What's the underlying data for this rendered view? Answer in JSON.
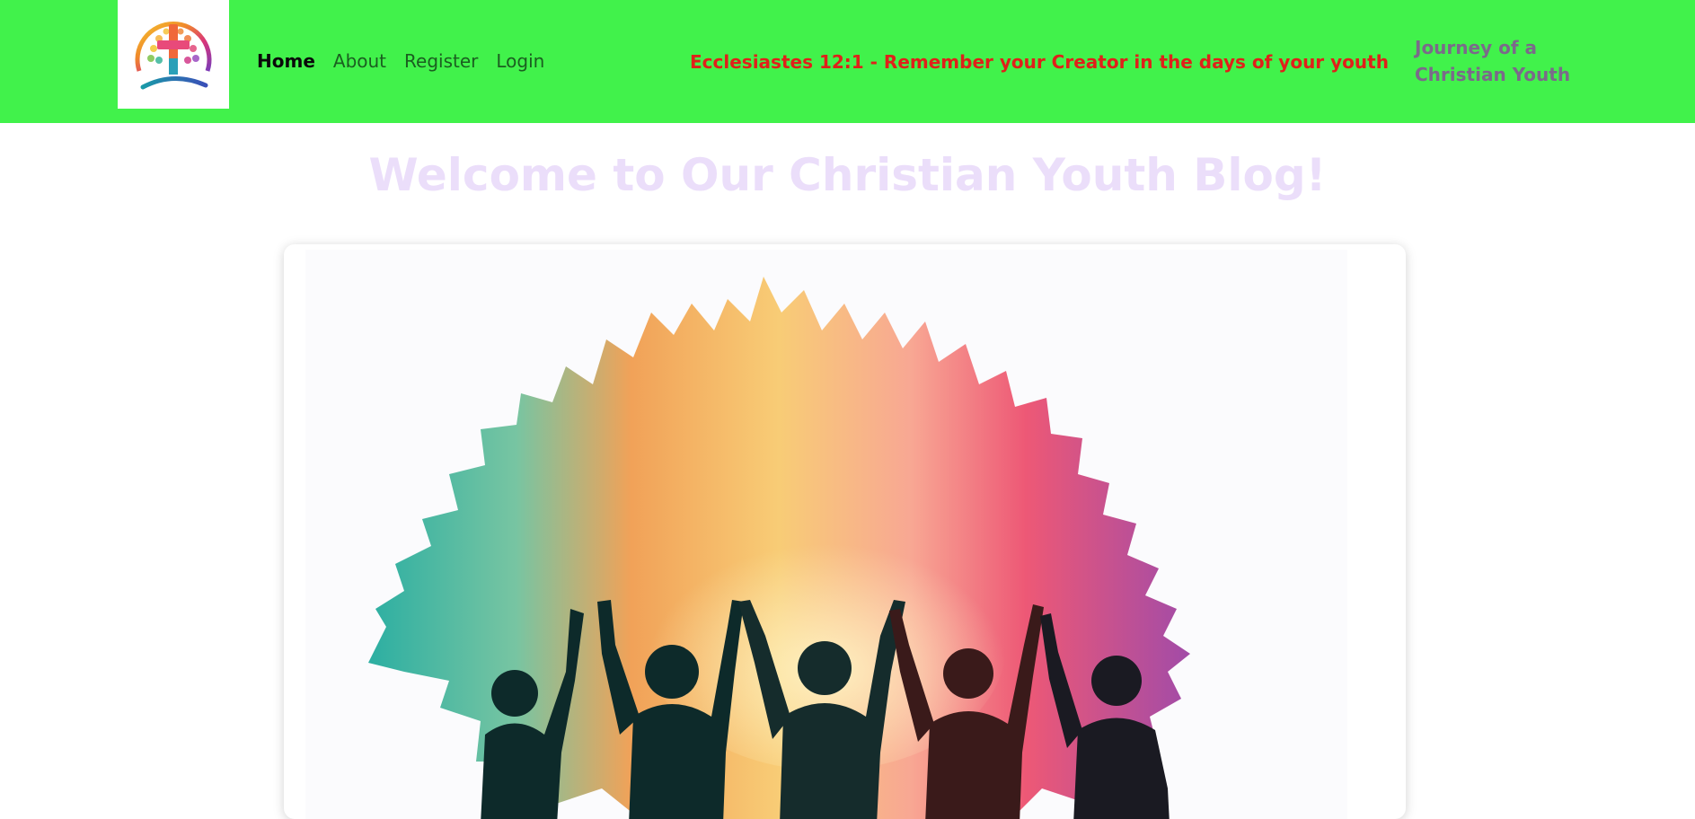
{
  "header": {
    "logo_alt": "Christian youth cross logo",
    "nav": [
      {
        "label": "Home",
        "active": true
      },
      {
        "label": "About",
        "active": false
      },
      {
        "label": "Register",
        "active": false
      },
      {
        "label": "Login",
        "active": false
      }
    ],
    "verse": "Ecclesiastes 12:1 - Remember your Creator in the days of your youth",
    "tagline": "Journey of a Christian Youth"
  },
  "main": {
    "heading": "Welcome to Our Christian Youth Blog!",
    "hero_image": "hero-illustration"
  },
  "colors": {
    "navbar_bg": "#41f24b",
    "verse": "#e0201a",
    "tagline": "#7b6a8a",
    "heading": "#ebdefa"
  }
}
